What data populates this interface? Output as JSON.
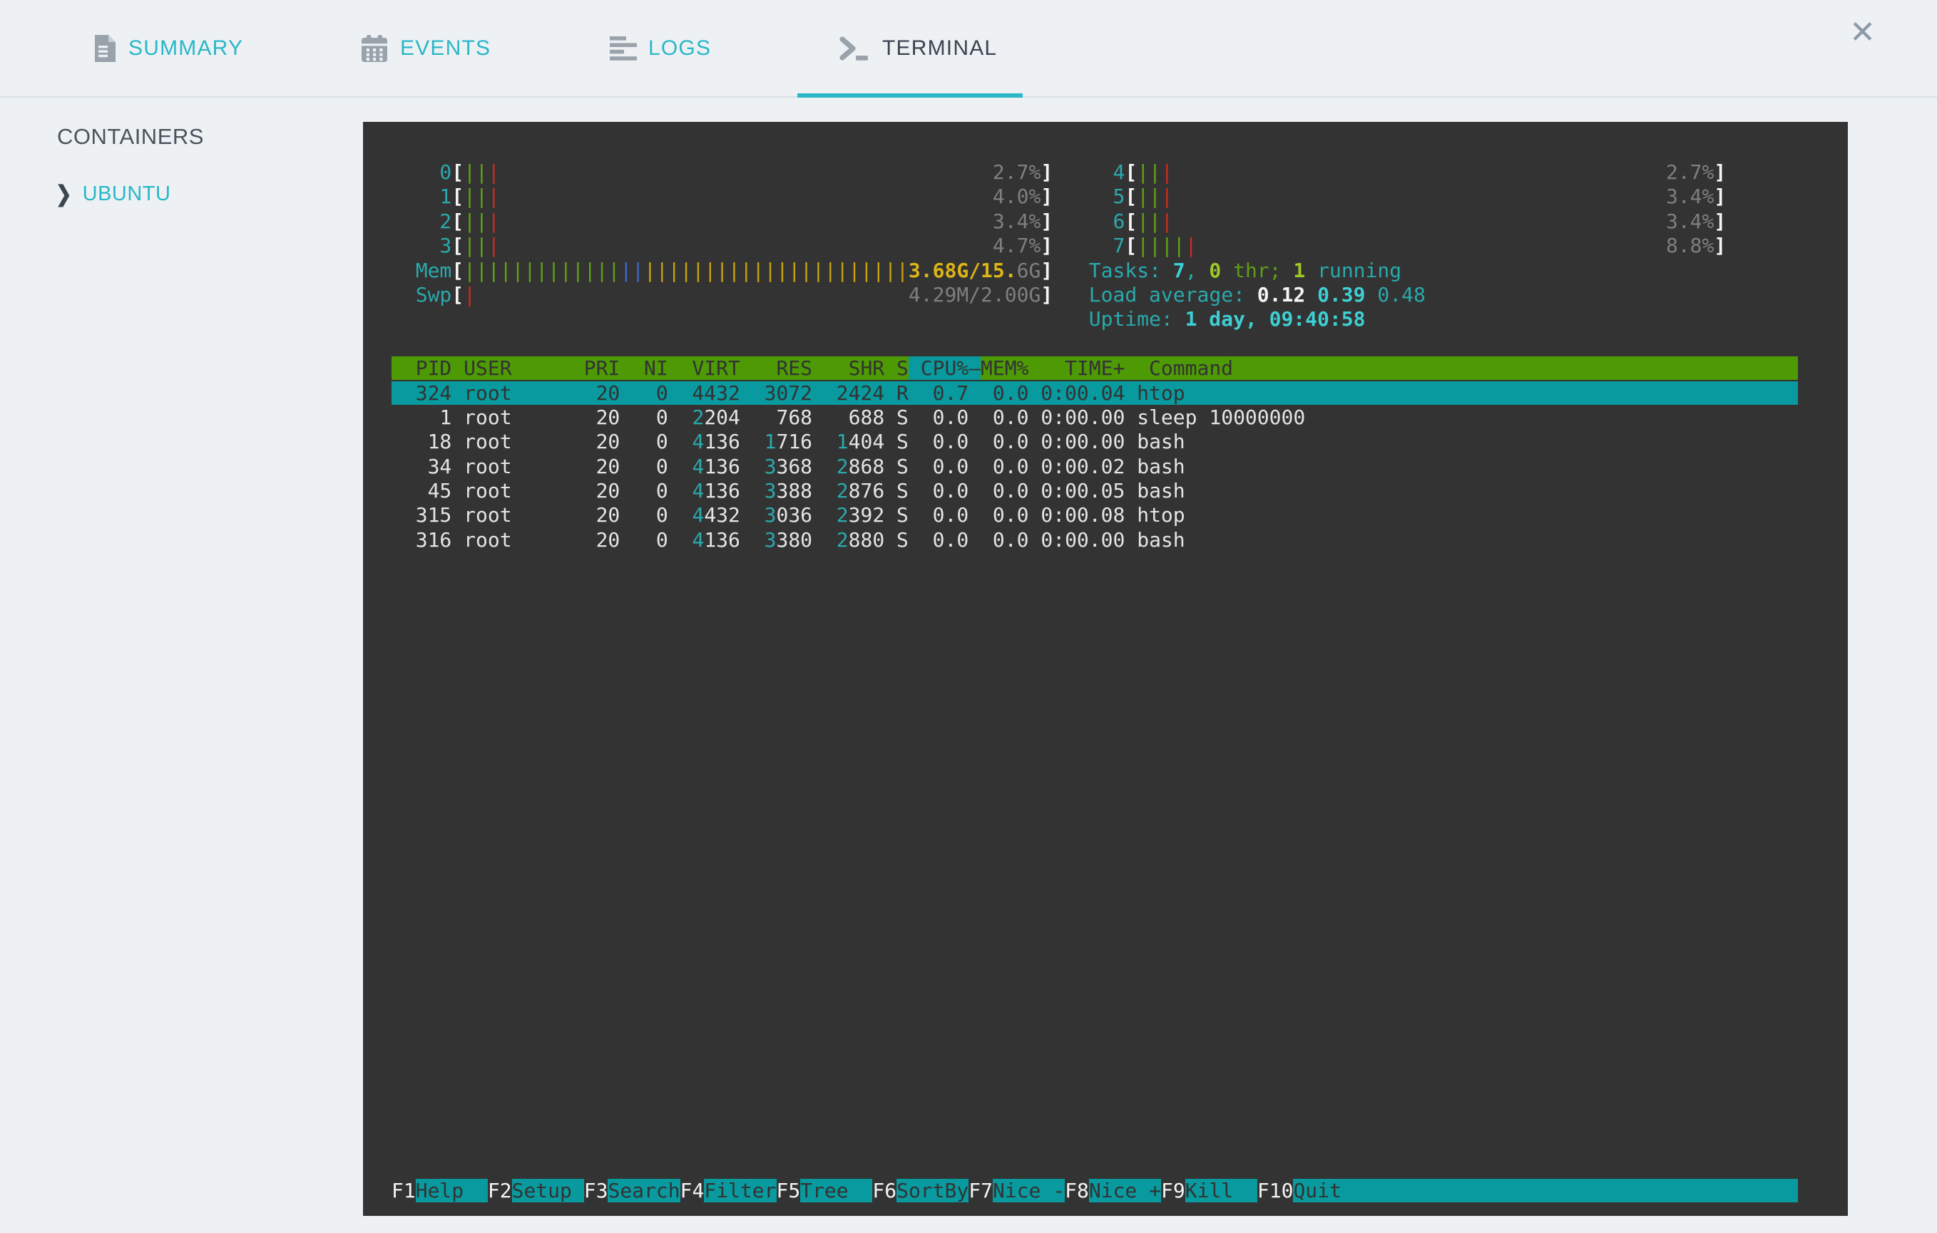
{
  "colors": {
    "page_bg": "#edf1f4",
    "divider": "#d9e0e6",
    "accent_cyan": "#2ab7c8",
    "tab_active_text": "#3a434f",
    "icon_gray": "#9aa3ab",
    "close_gray": "#8b9aab",
    "sidebar_heading": "#4a535c",
    "terminal_bg": "#333333",
    "txt": "#e4e4e4",
    "white_bright": "#f5f5f5",
    "term_gray": "#7f7f7f",
    "term_cyan": "#2aa9ac",
    "term_cyan_bright": "#3ecfd4",
    "term_green": "#5e9c1a",
    "term_green_bright": "#9cc927",
    "bar_green": "#61a313",
    "bar_red": "#cc2b20",
    "bar_blue": "#3e68c8",
    "bar_yellow": "#c9a40b",
    "yellow_text": "#ddb515",
    "header_green_bg": "#4d9a04",
    "teal_bg": "#089a9e",
    "dark_text": "#333333"
  },
  "header": {
    "tabs": [
      {
        "label": "SUMMARY",
        "icon": "document-icon",
        "active": false
      },
      {
        "label": "EVENTS",
        "icon": "calendar-icon",
        "active": false
      },
      {
        "label": "LOGS",
        "icon": "logs-icon",
        "active": false
      },
      {
        "label": "TERMINAL",
        "icon": "terminal-icon",
        "active": true
      }
    ],
    "close_glyph": "✕"
  },
  "sidebar": {
    "heading": "CONTAINERS",
    "chevron_glyph": "❯",
    "items": [
      {
        "label": "UBUNTU"
      }
    ]
  },
  "terminal": {
    "columns_total": 117,
    "meter_inner_width": 48,
    "cpu_meters_left": [
      {
        "label": "0",
        "bars": [
          [
            "green",
            2
          ],
          [
            "red",
            1
          ]
        ],
        "value": [
          [
            "2.7%",
            "gray"
          ]
        ]
      },
      {
        "label": "1",
        "bars": [
          [
            "green",
            2
          ],
          [
            "red",
            1
          ]
        ],
        "value": [
          [
            "4.0%",
            "gray"
          ]
        ]
      },
      {
        "label": "2",
        "bars": [
          [
            "green",
            2
          ],
          [
            "red",
            1
          ]
        ],
        "value": [
          [
            "3.4%",
            "gray"
          ]
        ]
      },
      {
        "label": "3",
        "bars": [
          [
            "green",
            2
          ],
          [
            "red",
            1
          ]
        ],
        "value": [
          [
            "4.7%",
            "gray"
          ]
        ]
      }
    ],
    "cpu_meters_right": [
      {
        "label": "4",
        "bars": [
          [
            "green",
            2
          ],
          [
            "red",
            1
          ]
        ],
        "value": [
          [
            "2.7%",
            "gray"
          ]
        ]
      },
      {
        "label": "5",
        "bars": [
          [
            "green",
            2
          ],
          [
            "red",
            1
          ]
        ],
        "value": [
          [
            "3.4%",
            "gray"
          ]
        ]
      },
      {
        "label": "6",
        "bars": [
          [
            "green",
            2
          ],
          [
            "red",
            1
          ]
        ],
        "value": [
          [
            "3.4%",
            "gray"
          ]
        ]
      },
      {
        "label": "7",
        "bars": [
          [
            "green",
            4
          ],
          [
            "red",
            1
          ]
        ],
        "value": [
          [
            "8.8%",
            "gray"
          ]
        ]
      }
    ],
    "mem_meter": {
      "label": "Mem",
      "bars": [
        [
          "green",
          13
        ],
        [
          "blue",
          2
        ],
        [
          "yellow",
          22
        ]
      ],
      "value": [
        [
          "3.68G/15.",
          "yellow_text"
        ],
        [
          "6G",
          "gray"
        ]
      ]
    },
    "swp_meter": {
      "label": "Swp",
      "bars": [
        [
          "red",
          1
        ]
      ],
      "value": [
        [
          "4.29M/2.00G",
          "gray"
        ]
      ]
    },
    "info": {
      "tasks": [
        [
          "Tasks: ",
          "cyan"
        ],
        [
          "7",
          "cyan_bold"
        ],
        [
          ", ",
          "cyan"
        ],
        [
          "0",
          "green_bold"
        ],
        [
          " thr; ",
          "green"
        ],
        [
          "1",
          "green_bold"
        ],
        [
          " running",
          "cyan"
        ]
      ],
      "load": [
        [
          "Load average: ",
          "cyan"
        ],
        [
          "0.12 ",
          "white_bold"
        ],
        [
          "0.39 ",
          "cyan_bold"
        ],
        [
          "0.48",
          "cyan"
        ]
      ],
      "uptime": [
        [
          "Uptime: ",
          "cyan"
        ],
        [
          "1 day, 09:40:58",
          "cyan_bold"
        ]
      ]
    },
    "table": {
      "columns": [
        "PID",
        "USER",
        "PRI",
        "NI",
        "VIRT",
        "RES",
        "SHR",
        "S",
        "CPU%",
        "MEM%",
        "TIME+",
        "Command"
      ],
      "sort_column": "CPU%",
      "sort_arrow": "–",
      "rows": [
        {
          "pid": "324",
          "user": "root",
          "pri": "20",
          "ni": "0",
          "virt": "4432",
          "res": "3072",
          "shr": "2424",
          "s": "R",
          "cpu": "0.7",
          "mem": "0.0",
          "time": "0:00.04",
          "cmd": "htop",
          "selected": true
        },
        {
          "pid": "1",
          "user": "root",
          "pri": "20",
          "ni": "0",
          "virt": "2204",
          "res": "768",
          "shr": "688",
          "s": "S",
          "cpu": "0.0",
          "mem": "0.0",
          "time": "0:00.00",
          "cmd": "sleep 10000000",
          "selected": false
        },
        {
          "pid": "18",
          "user": "root",
          "pri": "20",
          "ni": "0",
          "virt": "4136",
          "res": "1716",
          "shr": "1404",
          "s": "S",
          "cpu": "0.0",
          "mem": "0.0",
          "time": "0:00.00",
          "cmd": "bash",
          "selected": false
        },
        {
          "pid": "34",
          "user": "root",
          "pri": "20",
          "ni": "0",
          "virt": "4136",
          "res": "3368",
          "shr": "2868",
          "s": "S",
          "cpu": "0.0",
          "mem": "0.0",
          "time": "0:00.02",
          "cmd": "bash",
          "selected": false
        },
        {
          "pid": "45",
          "user": "root",
          "pri": "20",
          "ni": "0",
          "virt": "4136",
          "res": "3388",
          "shr": "2876",
          "s": "S",
          "cpu": "0.0",
          "mem": "0.0",
          "time": "0:00.05",
          "cmd": "bash",
          "selected": false
        },
        {
          "pid": "315",
          "user": "root",
          "pri": "20",
          "ni": "0",
          "virt": "4432",
          "res": "3036",
          "shr": "2392",
          "s": "S",
          "cpu": "0.0",
          "mem": "0.0",
          "time": "0:00.08",
          "cmd": "htop",
          "selected": false
        },
        {
          "pid": "316",
          "user": "root",
          "pri": "20",
          "ni": "0",
          "virt": "4136",
          "res": "3380",
          "shr": "2880",
          "s": "S",
          "cpu": "0.0",
          "mem": "0.0",
          "time": "0:00.00",
          "cmd": "bash",
          "selected": false
        }
      ]
    },
    "fkeys": [
      [
        "F1",
        "Help  "
      ],
      [
        "F2",
        "Setup "
      ],
      [
        "F3",
        "Search"
      ],
      [
        "F4",
        "Filter"
      ],
      [
        "F5",
        "Tree  "
      ],
      [
        "F6",
        "SortBy"
      ],
      [
        "F7",
        "Nice -"
      ],
      [
        "F8",
        "Nice +"
      ],
      [
        "F9",
        "Kill  "
      ],
      [
        "F10",
        "Quit  "
      ]
    ]
  }
}
